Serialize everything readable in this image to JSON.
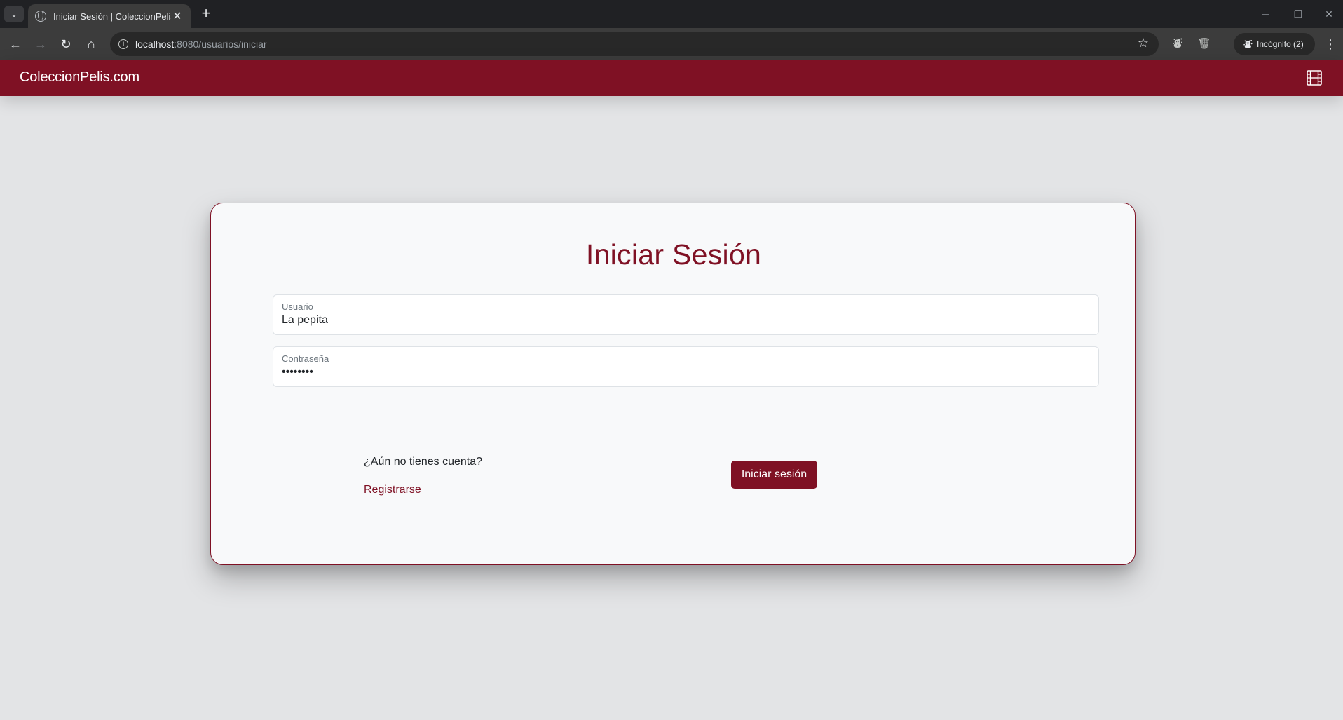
{
  "browser": {
    "tab_title": "Iniciar Sesión | ColeccionPelis",
    "tab_close": "✕",
    "new_tab": "+",
    "url_host": "localhost",
    "url_rest": ":8080/usuarios/iniciar",
    "profile_label": "Incógnito (2)"
  },
  "navbar": {
    "brand": "ColeccionPelis.com"
  },
  "login": {
    "title": "Iniciar Sesión",
    "username_label": "Usuario",
    "username_value": "La pepita",
    "password_label": "Contraseña",
    "password_value": "pepita12",
    "no_account_text": "¿Aún no tienes cuenta?",
    "register_link": "Registrarse",
    "submit_label": "Iniciar sesión"
  },
  "colors": {
    "brand": "#7f1124",
    "page_background": "#e3e4e6",
    "card_background": "#f8f9fa"
  }
}
